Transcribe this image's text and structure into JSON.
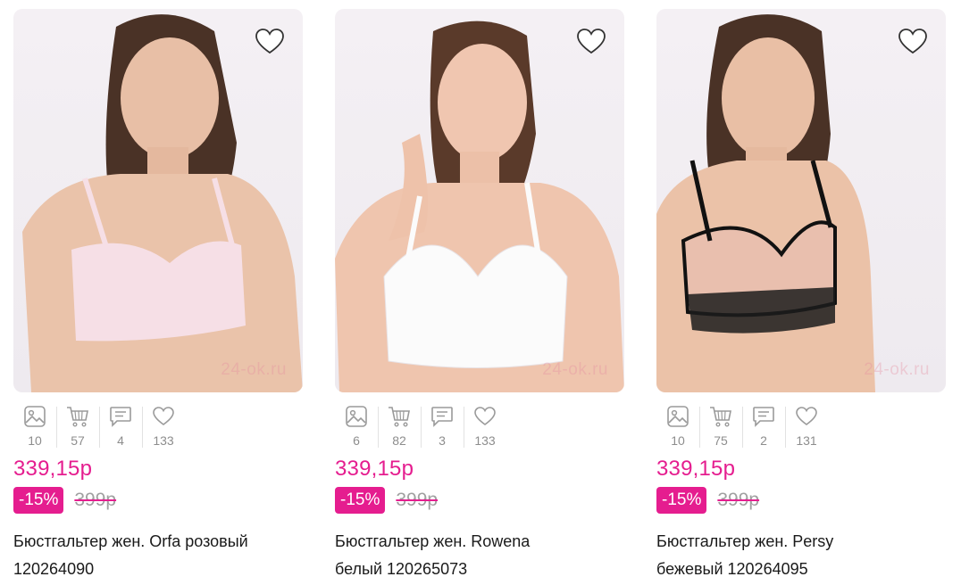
{
  "products": [
    {
      "photos": "10",
      "carts": "57",
      "reviews": "4",
      "likes": "133",
      "price": "339,15р",
      "discount": "-15%",
      "old_price": "399р",
      "title_line1": "Бюстгальтер жен. Orfa розовый",
      "title_line2": "120264090",
      "watermark": "24-ok.ru",
      "bra_color": "#f6dfe6"
    },
    {
      "photos": "6",
      "carts": "82",
      "reviews": "3",
      "likes": "133",
      "price": "339,15р",
      "discount": "-15%",
      "old_price": "399р",
      "title_line1": "Бюстгальтер жен. Rowena",
      "title_line2": "белый 120265073",
      "watermark": "24-ok.ru",
      "bra_color": "#fbfbfb"
    },
    {
      "photos": "10",
      "carts": "75",
      "reviews": "2",
      "likes": "131",
      "price": "339,15р",
      "discount": "-15%",
      "old_price": "399р",
      "title_line1": "Бюстгальтер жен. Persy",
      "title_line2": "бежевый 120264095",
      "watermark": "24-ok.ru",
      "bra_color": "#e9bfae"
    }
  ],
  "colors": {
    "accent": "#e51d8f",
    "muted_text": "#8d8d8d",
    "icon_gray": "#9a9a9a"
  },
  "icons": [
    "image-icon",
    "cart-icon",
    "comment-icon",
    "heart-icon",
    "favorite-heart-icon"
  ]
}
